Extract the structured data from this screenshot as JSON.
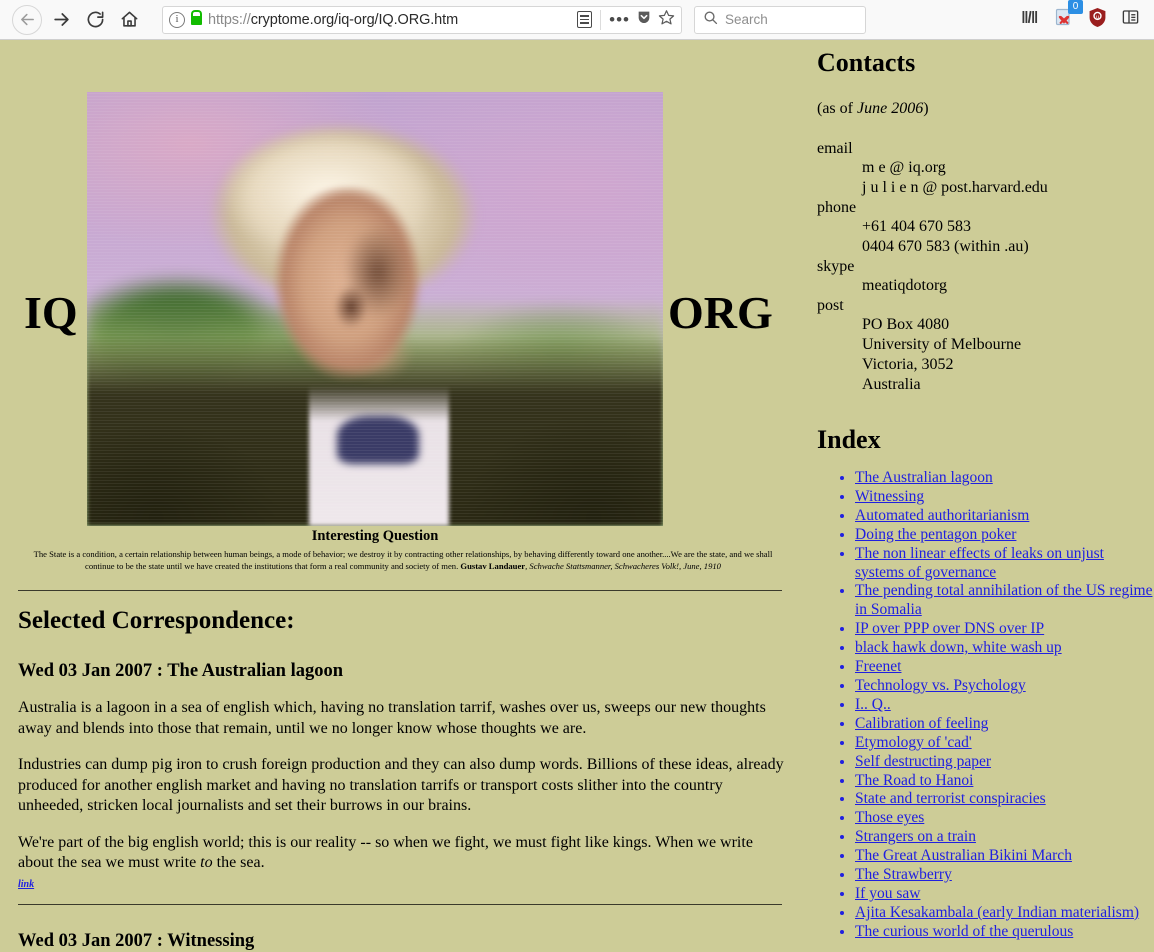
{
  "browser": {
    "url_dim_prefix": "https://",
    "url_main": "cryptome.org/iq-org/IQ.ORG.htm",
    "url_full": "https://cryptome.org/iq-org/IQ.ORG.htm",
    "search_placeholder": "Search",
    "back_icon": "back-arrow-icon",
    "forward_icon": "forward-arrow-icon",
    "reload_icon": "reload-icon",
    "home_icon": "home-icon",
    "info_icon": "page-info-icon",
    "lock_icon": "https-lock-icon",
    "reader_icon": "reader-view-icon",
    "menu_icon": "page-actions-icon",
    "pocket_icon": "pocket-icon",
    "star_icon": "bookmark-star-icon",
    "library_icon": "library-icon",
    "downloads_badge": "0",
    "ublock_icon": "ublock-origin-icon",
    "sidebar_icon": "sidebar-icon",
    "accent_badge_color": "#2c8fe4",
    "lock_color": "#12bc00",
    "ublock_color": "#9a1e1e"
  },
  "page": {
    "background_color": "#cdcc97",
    "link_color": "#2020e0",
    "banner": {
      "left_word": "IQ",
      "right_word": "ORG",
      "photo_alt": "portrait-photo",
      "caption": "Interesting Question"
    },
    "quote": {
      "body": "The State is a condition, a certain relationship between human beings, a mode of behavior; we destroy it by contracting other relationships, by behaving differently toward one another....We are the state, and we shall continue to be the state until we have created the institutions that form a real community and society of men. ",
      "author": "Gustav Landauer",
      "source": ", Schwache Stattsmanner, Schwacheres Volk!, June, 1910"
    },
    "correspondence": {
      "heading": "Selected Correspondence:",
      "entries": [
        {
          "title": "Wed 03 Jan 2007 : The Australian lagoon",
          "paragraphs": [
            "Australia is a lagoon in a sea of english which, having no translation tarrif, washes over us, sweeps our new thoughts away and blends into those that remain, until we no longer know whose thoughts we are.",
            "Industries can dump pig iron to crush foreign production and they can also dump words. Billions of these ideas, already produced for another english market and having no translation tarrifs or transport costs slither into the country unheeded, stricken local journalists and set their burrows in our brains."
          ],
          "last_paragraph_pre": "We're part of the big english world; this is our reality -- so when we fight, we must fight like kings. When we write about the sea we must write ",
          "last_paragraph_em": "to",
          "last_paragraph_post": " the sea.",
          "link_label": "link"
        },
        {
          "title": "Wed 03 Jan 2007 : Witnessing"
        }
      ]
    }
  },
  "sidebar": {
    "contacts": {
      "heading": "Contacts",
      "as_of_pre": "(as of ",
      "as_of_em": "June 2006",
      "as_of_post": ")",
      "groups": [
        {
          "label": "email",
          "values": [
            "m e @ iq.org",
            "j u l i e n @ post.harvard.edu"
          ]
        },
        {
          "label": "phone",
          "values": [
            "+61 404 670 583",
            "0404 670 583 (within .au)"
          ]
        },
        {
          "label": "skype",
          "values": [
            "meatiqdotorg"
          ]
        },
        {
          "label": "post",
          "values": [
            "PO Box 4080",
            "University of Melbourne",
            "Victoria, 3052",
            "Australia"
          ]
        }
      ]
    },
    "index": {
      "heading": "Index",
      "items": [
        "The Australian lagoon",
        "Witnessing",
        "Automated authoritarianism",
        "Doing the pentagon poker",
        "The non linear effects of leaks on unjust systems of governance",
        "The pending total annihilation of the US regime in Somalia",
        "IP over PPP over DNS over IP",
        "black hawk down, white wash up",
        "Freenet",
        "Technology vs. Psychology",
        "I.. Q..",
        "Calibration of feeling",
        "Etymology of 'cad'",
        "Self destructing paper",
        "The Road to Hanoi",
        "State and terrorist conspiracies",
        "Those eyes",
        "Strangers on a train",
        "The Great Australian Bikini March",
        "The Strawberry",
        "If you saw",
        "Ajita Kesakambala (early Indian materialism)",
        "The curious world of the querulous"
      ]
    }
  }
}
